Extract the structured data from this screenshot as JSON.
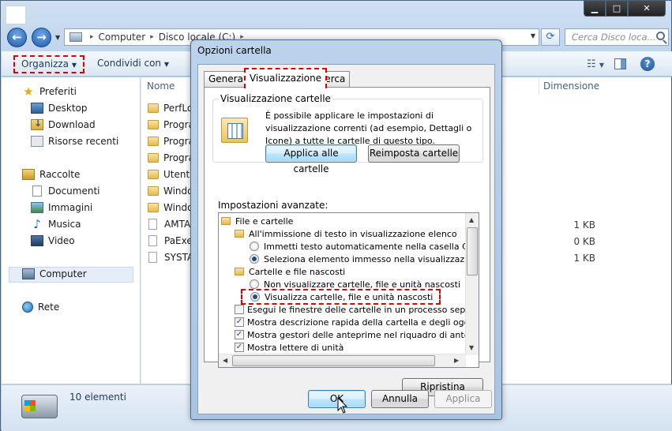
{
  "explorer": {
    "address": {
      "segments": [
        "Computer",
        "Disco locale (C:)"
      ]
    },
    "search_placeholder": "Cerca Disco loca...",
    "toolbar": {
      "organize": "Organizza",
      "share": "Condividi con"
    },
    "sidebar": {
      "favorites": "Preferiti",
      "desktop": "Desktop",
      "download": "Download",
      "recent": "Risorse recenti",
      "libraries": "Raccolte",
      "documents": "Documenti",
      "images": "Immagini",
      "music": "Musica",
      "video": "Video",
      "computer": "Computer",
      "network": "Rete"
    },
    "columns": {
      "name": "Nome",
      "size": "Dimensione"
    },
    "files": [
      {
        "name": "PerfLo",
        "type": "folder",
        "size": ""
      },
      {
        "name": "Progra",
        "type": "folder",
        "size": ""
      },
      {
        "name": "Progra",
        "type": "folder",
        "size": ""
      },
      {
        "name": "Progra",
        "type": "folder",
        "size": ""
      },
      {
        "name": "Utenti",
        "type": "folder",
        "size": ""
      },
      {
        "name": "Windo",
        "type": "folder",
        "size": ""
      },
      {
        "name": "Windo",
        "type": "folder",
        "size": ""
      },
      {
        "name": "AMTA",
        "type": "file",
        "size": "1 KB"
      },
      {
        "name": "PaExeI",
        "type": "file",
        "size": "0 KB"
      },
      {
        "name": "SYSTA",
        "type": "file",
        "size": "1 KB"
      }
    ],
    "status": "10 elementi"
  },
  "dialog": {
    "title": "Opzioni cartella",
    "tabs": [
      "Generale",
      "Visualizzazione",
      "Cerca"
    ],
    "folder_view": {
      "group_title": "Visualizzazione cartelle",
      "description": "È possibile applicare le impostazioni di visualizzazione correnti (ad esempio, Dettagli o Icone) a tutte le cartelle di questo tipo.",
      "apply_btn": "Applica alle cartelle",
      "reset_btn": "Reimposta cartelle"
    },
    "advanced_label": "Impostazioni avanzate:",
    "tree": {
      "root": "File e cartelle",
      "typing_group": "All'immissione di testo in visualizzazione elenco",
      "typing_opt1": "Immetti testo automaticamente nella casella Cerca",
      "typing_opt2": "Seleziona elemento immesso nella visualizzazione",
      "hidden_group": "Cartelle e file nascosti",
      "hidden_opt1": "Non visualizzare cartelle, file e unità nascosti",
      "hidden_opt2": "Visualizza cartelle, file e unità nascosti",
      "chk1": "Esegui le finestre delle cartelle in un processo separato",
      "chk2": "Mostra descrizione rapida della cartella e degli oggetti del",
      "chk3": "Mostra gestori delle anteprime nel riquadro di anteprima",
      "chk4": "Mostra lettere di unità"
    },
    "restore_btn": "Ripristina",
    "ok_btn": "OK",
    "cancel_btn": "Annulla",
    "apply_btn": "Applica"
  },
  "colors": {
    "highlight_dash": "#e00000",
    "accent": "#1f5aa8"
  }
}
